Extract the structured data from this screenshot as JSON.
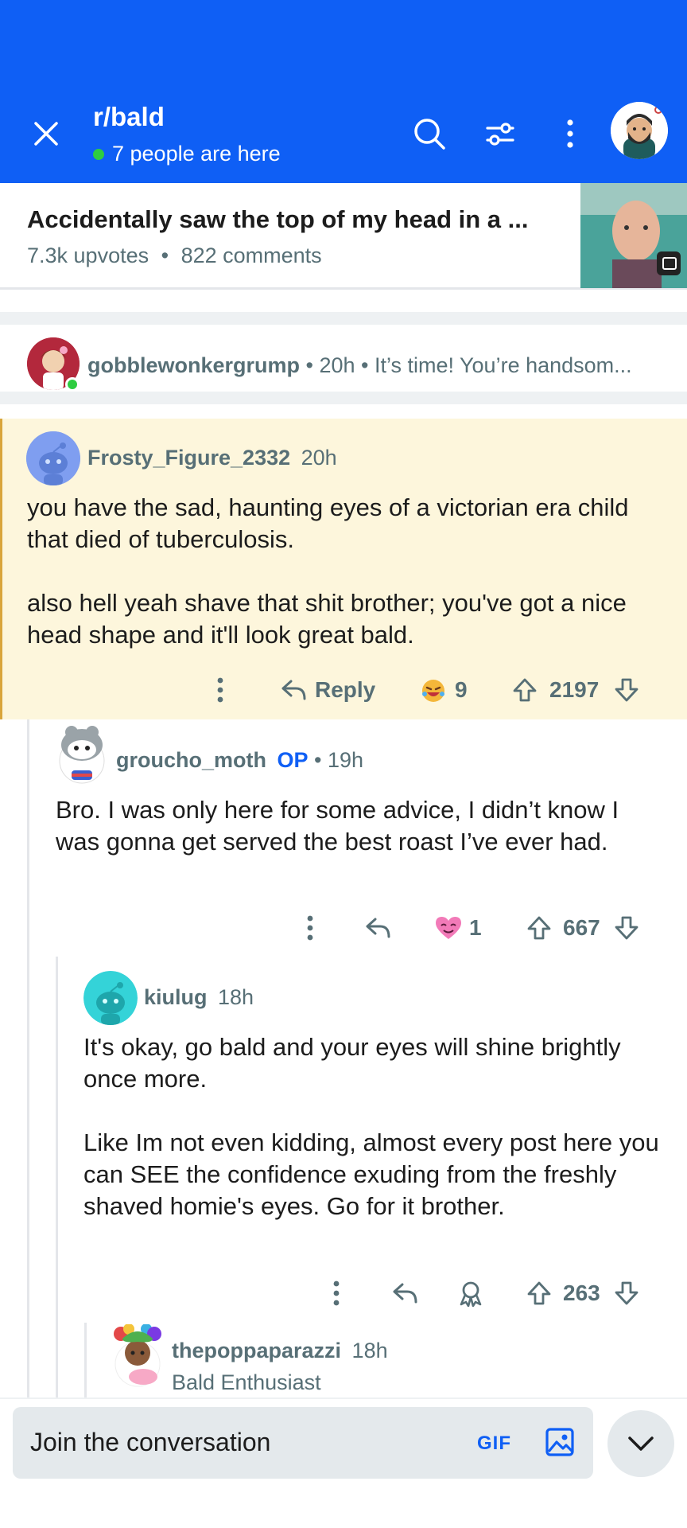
{
  "colors": {
    "brand_blue": "#0f5ff5",
    "highlight_bg": "#fdf6dc",
    "highlight_border": "#d9a53c",
    "muted": "#576f76",
    "online": "#2ecc40"
  },
  "header": {
    "subreddit": "r/bald",
    "presence": "7 people are here",
    "icons": [
      "close-icon",
      "search-icon",
      "filter-icon",
      "overflow-icon",
      "user-avatar"
    ]
  },
  "post": {
    "title": "Accidentally saw the top of my head in a ...",
    "upvotes": "7.3k upvotes",
    "separator": "•",
    "comments": "822 comments"
  },
  "parent": {
    "username": "gobblewonkergrump",
    "meta": " • 20h • It’s time! You’re handsom..."
  },
  "comments": [
    {
      "username": "Frosty_Figure_2332",
      "time": "20h",
      "body": [
        "you have the sad, haunting eyes of a victorian era child that died of tuberculosis.",
        "also hell yeah shave that shit brother; you've got a nice head shape and it'll look great bald."
      ],
      "reply_label": "Reply",
      "award_count": "9",
      "score": "2197"
    },
    {
      "username": "groucho_moth",
      "op_label": "OP",
      "time": " • 19h",
      "body": [
        "Bro. I was only here for some advice, I didn’t know I was gonna get served the best roast I’ve ever had."
      ],
      "award_count": "1",
      "score": "667"
    },
    {
      "username": "kiulug",
      "time": "18h",
      "body": [
        "It's okay, go bald and your eyes will shine brightly once more.",
        "Like Im not even kidding, almost every post here you can SEE the confidence exuding from the freshly shaved homie's eyes. Go for it brother."
      ],
      "score": "263"
    },
    {
      "username": "thepoppaparazzi",
      "time": "18h",
      "flair": "Bald Enthusiast"
    }
  ],
  "composer": {
    "placeholder": "Join the conversation",
    "gif_label": "GIF"
  }
}
